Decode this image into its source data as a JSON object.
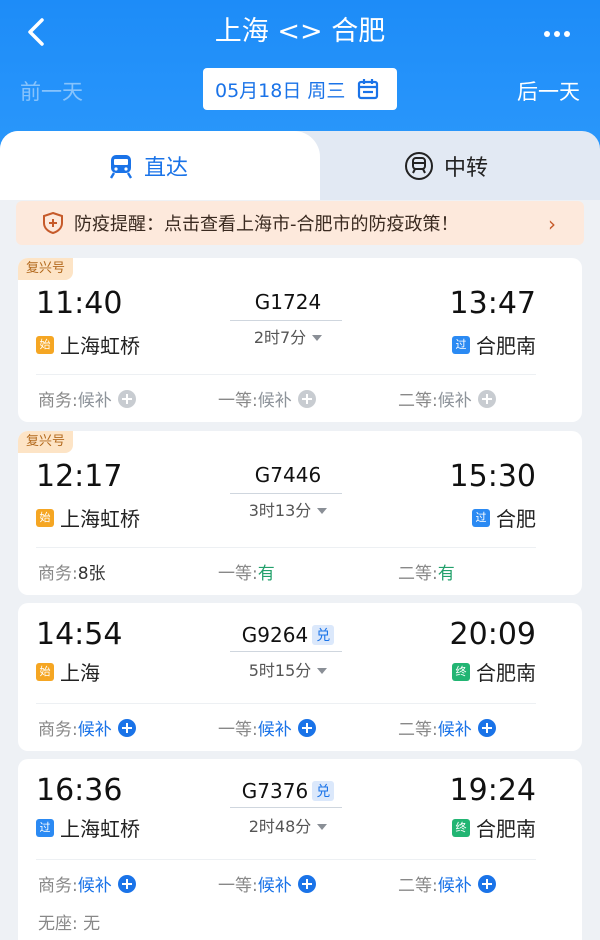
{
  "nav": {
    "title": "上海 <> 合肥",
    "prev_day": "前一天",
    "next_day": "后一天",
    "date": "05月18日 周三"
  },
  "tabs": [
    {
      "label": "直达"
    },
    {
      "label": "中转"
    }
  ],
  "notice": {
    "text": "防疫提醒：点击查看上海市-合肥市的防疫政策！",
    "chevron": "›"
  },
  "trains": [
    {
      "badge": "复兴号",
      "dep_time": "11:40",
      "dep_tag": "始",
      "dep_station": "上海虹桥",
      "train_no": "G1724",
      "duitag": "",
      "duration": "2时7分",
      "arr_time": "13:47",
      "arr_tag": "过",
      "arr_station": "合肥南",
      "seats": [
        {
          "label": "商务: ",
          "value": "候补"
        },
        {
          "label": "一等: ",
          "value": "候补"
        },
        {
          "label": "二等: ",
          "value": "候补"
        }
      ]
    },
    {
      "badge": "复兴号",
      "dep_time": "12:17",
      "dep_tag": "始",
      "dep_station": "上海虹桥",
      "train_no": "G7446",
      "duitag": "",
      "duration": "3时13分",
      "arr_time": "15:30",
      "arr_tag": "过",
      "arr_station": "合肥",
      "seats": [
        {
          "label": "商务: ",
          "value": "8张"
        },
        {
          "label": "一等: ",
          "value": "有"
        },
        {
          "label": "二等: ",
          "value": "有"
        }
      ]
    },
    {
      "badge": "",
      "dep_time": "14:54",
      "dep_tag": "始",
      "dep_station": "上海",
      "train_no": "G9264",
      "duitag": "兑",
      "duration": "5时15分",
      "arr_time": "20:09",
      "arr_tag": "终",
      "arr_station": "合肥南",
      "seats": [
        {
          "label": "商务: ",
          "value": "候补"
        },
        {
          "label": "一等: ",
          "value": "候补"
        },
        {
          "label": "二等: ",
          "value": "候补"
        }
      ]
    },
    {
      "badge": "",
      "dep_time": "16:36",
      "dep_tag": "过",
      "dep_station": "上海虹桥",
      "train_no": "G7376",
      "duitag": "兑",
      "duration": "2时48分",
      "arr_time": "19:24",
      "arr_tag": "终",
      "arr_station": "合肥南",
      "seats": [
        {
          "label": "商务: ",
          "value": "候补"
        },
        {
          "label": "一等: ",
          "value": "候补"
        },
        {
          "label": "二等: ",
          "value": "候补"
        }
      ],
      "no_seat": "无座: 无"
    }
  ],
  "colors": {
    "brand_blue": "#1a73e8",
    "header_blue": "#1d8cf8",
    "available_green": "#22a06b",
    "notice_bg": "#fde9dc"
  },
  "icons": [
    "back-icon",
    "more-icon",
    "calendar-icon",
    "train-icon",
    "transfer-train-icon",
    "shield-icon",
    "plus-icon"
  ]
}
